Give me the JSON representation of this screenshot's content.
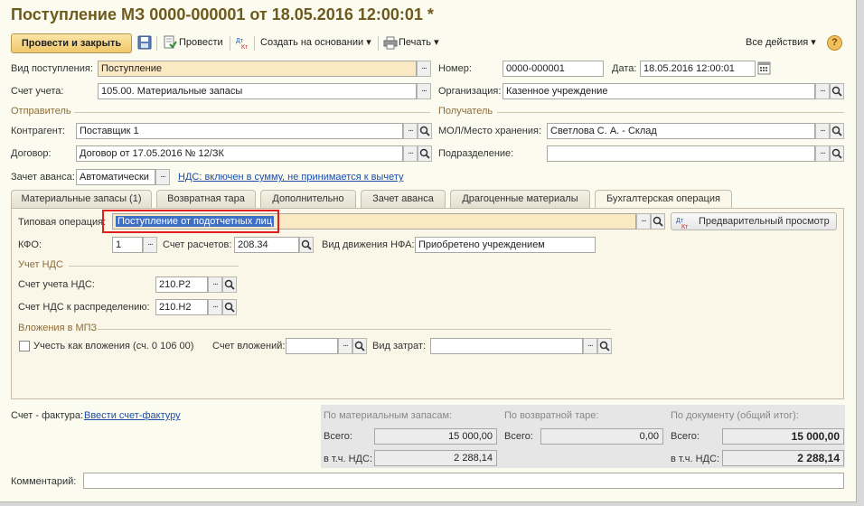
{
  "header": {
    "title": "Поступление МЗ 0000-000001 от 18.05.2016 12:00:01 *"
  },
  "toolbar": {
    "post_close": "Провести и закрыть",
    "post": "Провести",
    "create_based": "Создать на основании",
    "print": "Печать",
    "all_actions": "Все действия",
    "help": "?"
  },
  "form": {
    "receipt_type_label": "Вид поступления:",
    "receipt_type_value": "Поступление",
    "number_label": "Номер:",
    "number_value": "0000-000001",
    "date_label": "Дата:",
    "date_value": "18.05.2016 12:00:01",
    "account_label": "Счет учета:",
    "account_value": "105.00. Материальные запасы",
    "org_label": "Организация:",
    "org_value": "Казенное учреждение",
    "sender_section": "Отправитель",
    "receiver_section": "Получатель",
    "counterparty_label": "Контрагент:",
    "counterparty_value": "Поставщик 1",
    "mol_label": "МОЛ/Место хранения:",
    "mol_value": "Светлова С. А. - Склад",
    "contract_label": "Договор:",
    "contract_value": "Договор от 17.05.2016 № 12/ЗК",
    "subdivision_label": "Подразделение:",
    "subdivision_value": "",
    "advance_label": "Зачет аванса:",
    "advance_value": "Автоматически",
    "vat_link": "НДС: включен в сумму, не принимается к вычету"
  },
  "tabs": [
    {
      "label": "Материальные запасы (1)"
    },
    {
      "label": "Возвратная тара"
    },
    {
      "label": "Дополнительно"
    },
    {
      "label": "Зачет аванса"
    },
    {
      "label": "Драгоценные материалы"
    },
    {
      "label": "Бухгалтерская операция"
    }
  ],
  "operation": {
    "typical_label": "Типовая операция:",
    "typical_value": "Поступление от подотчетных лиц",
    "preview_button": "Предварительный просмотр",
    "kfo_label": "КФО:",
    "kfo_value": "1",
    "settle_label": "Счет расчетов:",
    "settle_value": "208.34",
    "nfa_label": "Вид движения НФА:",
    "nfa_value": "Приобретено учреждением",
    "vat_section": "Учет НДС",
    "vat_account_label": "Счет учета НДС:",
    "vat_account_value": "210.Р2",
    "vat_dist_label": "Счет НДС к распределению:",
    "vat_dist_value": "210.Н2",
    "invest_section": "Вложения в МПЗ",
    "invest_check_label": "Учесть как вложения (сч. 0 106 00)",
    "invest_account_label": "Счет вложений:",
    "invest_account_value": "",
    "cost_type_label": "Вид затрат:",
    "cost_type_value": ""
  },
  "footer": {
    "invoice_label": "Счет - фактура:",
    "invoice_link": "Ввести счет-фактуру",
    "mat_header": "По материальным запасам:",
    "tare_header": "По возвратной таре:",
    "doc_header": "По документу (общий итог):",
    "total_label": "Всего:",
    "vat_incl_label": "в т.ч. НДС:",
    "mat_total": "15 000,00",
    "mat_vat": "2 288,14",
    "tare_total": "0,00",
    "doc_total": "15 000,00",
    "doc_vat": "2 288,14",
    "comment_label": "Комментарий:",
    "comment_value": ""
  },
  "icons": {
    "ellipsis": "...",
    "search": "search-icon",
    "dropdown": "▾",
    "calendar": "calendar-icon"
  },
  "colors": {
    "title": "#6e5a1e",
    "section": "#8c6d3a",
    "link": "#1c4fa8",
    "highlight": "#fbe9c4",
    "selection": "#3f6fc4",
    "callout": "#e01e1e"
  }
}
